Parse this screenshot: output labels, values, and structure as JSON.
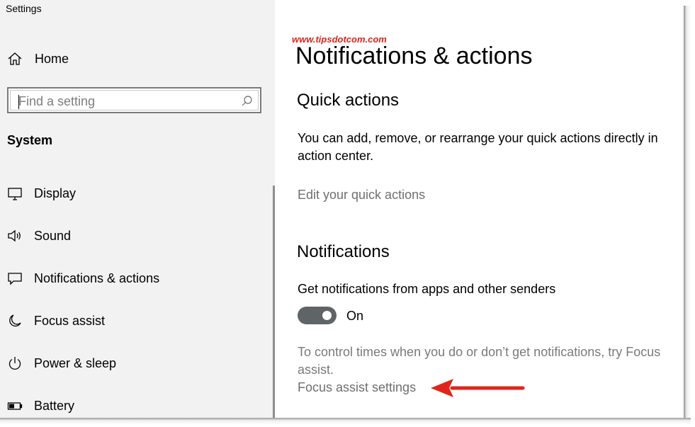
{
  "window": {
    "title": "Settings"
  },
  "sidebar": {
    "home_label": "Home",
    "search": {
      "placeholder": "Find a setting",
      "value": ""
    },
    "section": "System",
    "items": [
      {
        "label": "Display",
        "icon": "display-icon"
      },
      {
        "label": "Sound",
        "icon": "speaker-icon"
      },
      {
        "label": "Notifications & actions",
        "icon": "message-icon"
      },
      {
        "label": "Focus assist",
        "icon": "moon-icon"
      },
      {
        "label": "Power & sleep",
        "icon": "power-icon"
      },
      {
        "label": "Battery",
        "icon": "battery-icon"
      }
    ]
  },
  "main": {
    "watermark": "www.tipsdotcom.com",
    "title": "Notifications & actions",
    "quick_actions": {
      "heading": "Quick actions",
      "description": "You can add, remove, or rearrange your quick actions directly in action center.",
      "edit_link": "Edit your quick actions"
    },
    "notifications": {
      "heading": "Notifications",
      "toggle_label": "Get notifications from apps and other senders",
      "toggle_state": "On",
      "toggle_on": true,
      "focus_hint": "To control times when you do or don’t get notifications, try Focus assist.",
      "focus_link": "Focus assist settings"
    }
  },
  "colors": {
    "sidebar_bg": "#f2f2f2",
    "toggle_on": "#5f6466",
    "link": "#6f6f6f",
    "annotation": "#e0251b"
  }
}
